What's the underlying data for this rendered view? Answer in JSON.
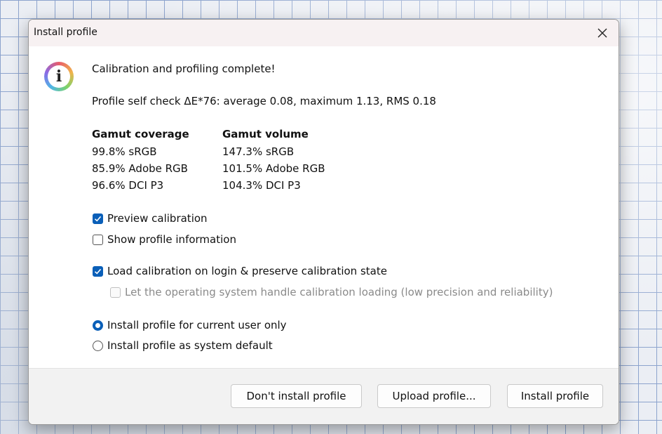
{
  "window": {
    "title": "Install profile"
  },
  "message": {
    "headline": "Calibration and profiling complete!",
    "self_check": "Profile self check ΔE*76: average 0.08, maximum 1.13, RMS 0.18"
  },
  "gamut": {
    "coverage_header": "Gamut coverage",
    "volume_header": "Gamut volume",
    "coverage": [
      "99.8% sRGB",
      "85.9% Adobe RGB",
      "96.6% DCI P3"
    ],
    "volume": [
      "147.3% sRGB",
      "101.5% Adobe RGB",
      "104.3% DCI P3"
    ]
  },
  "options": {
    "preview_calibration": {
      "label": "Preview calibration",
      "checked": true
    },
    "show_profile_info": {
      "label": "Show profile information",
      "checked": false
    },
    "load_calibration": {
      "label": "Load calibration on login & preserve calibration state",
      "checked": true
    },
    "os_handle_loading": {
      "label": "Let the operating system handle calibration loading (low precision and reliability)",
      "checked": false,
      "disabled": true
    },
    "install_current_user": {
      "label": "Install profile for current user only",
      "selected": true
    },
    "install_system_default": {
      "label": "Install profile as system default",
      "selected": false
    }
  },
  "buttons": {
    "dont_install": "Don't install profile",
    "upload": "Upload profile...",
    "install": "Install profile"
  },
  "colors": {
    "accent": "#0a5fb8"
  }
}
